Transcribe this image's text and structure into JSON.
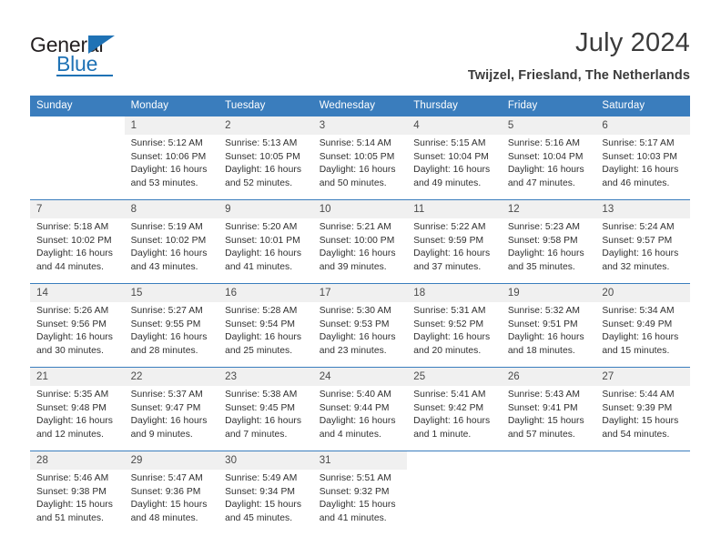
{
  "brand": {
    "word1": "General",
    "word2": "Blue",
    "triangle_icon": "triangle-icon",
    "accent_color": "#1f72b5"
  },
  "header": {
    "month_title": "July 2024",
    "location": "Twijzel, Friesland, The Netherlands"
  },
  "colors": {
    "header_row": "#3a7dbd",
    "daynum_row": "#f0f0f0",
    "text": "#2f2f2f",
    "title": "#3b3b3b"
  },
  "calendar": {
    "weekday_headers": [
      "Sunday",
      "Monday",
      "Tuesday",
      "Wednesday",
      "Thursday",
      "Friday",
      "Saturday"
    ],
    "weeks": [
      {
        "days": [
          {
            "num": "",
            "lines": []
          },
          {
            "num": "1",
            "lines": [
              "Sunrise: 5:12 AM",
              "Sunset: 10:06 PM",
              "Daylight: 16 hours",
              "and 53 minutes."
            ]
          },
          {
            "num": "2",
            "lines": [
              "Sunrise: 5:13 AM",
              "Sunset: 10:05 PM",
              "Daylight: 16 hours",
              "and 52 minutes."
            ]
          },
          {
            "num": "3",
            "lines": [
              "Sunrise: 5:14 AM",
              "Sunset: 10:05 PM",
              "Daylight: 16 hours",
              "and 50 minutes."
            ]
          },
          {
            "num": "4",
            "lines": [
              "Sunrise: 5:15 AM",
              "Sunset: 10:04 PM",
              "Daylight: 16 hours",
              "and 49 minutes."
            ]
          },
          {
            "num": "5",
            "lines": [
              "Sunrise: 5:16 AM",
              "Sunset: 10:04 PM",
              "Daylight: 16 hours",
              "and 47 minutes."
            ]
          },
          {
            "num": "6",
            "lines": [
              "Sunrise: 5:17 AM",
              "Sunset: 10:03 PM",
              "Daylight: 16 hours",
              "and 46 minutes."
            ]
          }
        ]
      },
      {
        "days": [
          {
            "num": "7",
            "lines": [
              "Sunrise: 5:18 AM",
              "Sunset: 10:02 PM",
              "Daylight: 16 hours",
              "and 44 minutes."
            ]
          },
          {
            "num": "8",
            "lines": [
              "Sunrise: 5:19 AM",
              "Sunset: 10:02 PM",
              "Daylight: 16 hours",
              "and 43 minutes."
            ]
          },
          {
            "num": "9",
            "lines": [
              "Sunrise: 5:20 AM",
              "Sunset: 10:01 PM",
              "Daylight: 16 hours",
              "and 41 minutes."
            ]
          },
          {
            "num": "10",
            "lines": [
              "Sunrise: 5:21 AM",
              "Sunset: 10:00 PM",
              "Daylight: 16 hours",
              "and 39 minutes."
            ]
          },
          {
            "num": "11",
            "lines": [
              "Sunrise: 5:22 AM",
              "Sunset: 9:59 PM",
              "Daylight: 16 hours",
              "and 37 minutes."
            ]
          },
          {
            "num": "12",
            "lines": [
              "Sunrise: 5:23 AM",
              "Sunset: 9:58 PM",
              "Daylight: 16 hours",
              "and 35 minutes."
            ]
          },
          {
            "num": "13",
            "lines": [
              "Sunrise: 5:24 AM",
              "Sunset: 9:57 PM",
              "Daylight: 16 hours",
              "and 32 minutes."
            ]
          }
        ]
      },
      {
        "days": [
          {
            "num": "14",
            "lines": [
              "Sunrise: 5:26 AM",
              "Sunset: 9:56 PM",
              "Daylight: 16 hours",
              "and 30 minutes."
            ]
          },
          {
            "num": "15",
            "lines": [
              "Sunrise: 5:27 AM",
              "Sunset: 9:55 PM",
              "Daylight: 16 hours",
              "and 28 minutes."
            ]
          },
          {
            "num": "16",
            "lines": [
              "Sunrise: 5:28 AM",
              "Sunset: 9:54 PM",
              "Daylight: 16 hours",
              "and 25 minutes."
            ]
          },
          {
            "num": "17",
            "lines": [
              "Sunrise: 5:30 AM",
              "Sunset: 9:53 PM",
              "Daylight: 16 hours",
              "and 23 minutes."
            ]
          },
          {
            "num": "18",
            "lines": [
              "Sunrise: 5:31 AM",
              "Sunset: 9:52 PM",
              "Daylight: 16 hours",
              "and 20 minutes."
            ]
          },
          {
            "num": "19",
            "lines": [
              "Sunrise: 5:32 AM",
              "Sunset: 9:51 PM",
              "Daylight: 16 hours",
              "and 18 minutes."
            ]
          },
          {
            "num": "20",
            "lines": [
              "Sunrise: 5:34 AM",
              "Sunset: 9:49 PM",
              "Daylight: 16 hours",
              "and 15 minutes."
            ]
          }
        ]
      },
      {
        "days": [
          {
            "num": "21",
            "lines": [
              "Sunrise: 5:35 AM",
              "Sunset: 9:48 PM",
              "Daylight: 16 hours",
              "and 12 minutes."
            ]
          },
          {
            "num": "22",
            "lines": [
              "Sunrise: 5:37 AM",
              "Sunset: 9:47 PM",
              "Daylight: 16 hours",
              "and 9 minutes."
            ]
          },
          {
            "num": "23",
            "lines": [
              "Sunrise: 5:38 AM",
              "Sunset: 9:45 PM",
              "Daylight: 16 hours",
              "and 7 minutes."
            ]
          },
          {
            "num": "24",
            "lines": [
              "Sunrise: 5:40 AM",
              "Sunset: 9:44 PM",
              "Daylight: 16 hours",
              "and 4 minutes."
            ]
          },
          {
            "num": "25",
            "lines": [
              "Sunrise: 5:41 AM",
              "Sunset: 9:42 PM",
              "Daylight: 16 hours",
              "and 1 minute."
            ]
          },
          {
            "num": "26",
            "lines": [
              "Sunrise: 5:43 AM",
              "Sunset: 9:41 PM",
              "Daylight: 15 hours",
              "and 57 minutes."
            ]
          },
          {
            "num": "27",
            "lines": [
              "Sunrise: 5:44 AM",
              "Sunset: 9:39 PM",
              "Daylight: 15 hours",
              "and 54 minutes."
            ]
          }
        ]
      },
      {
        "days": [
          {
            "num": "28",
            "lines": [
              "Sunrise: 5:46 AM",
              "Sunset: 9:38 PM",
              "Daylight: 15 hours",
              "and 51 minutes."
            ]
          },
          {
            "num": "29",
            "lines": [
              "Sunrise: 5:47 AM",
              "Sunset: 9:36 PM",
              "Daylight: 15 hours",
              "and 48 minutes."
            ]
          },
          {
            "num": "30",
            "lines": [
              "Sunrise: 5:49 AM",
              "Sunset: 9:34 PM",
              "Daylight: 15 hours",
              "and 45 minutes."
            ]
          },
          {
            "num": "31",
            "lines": [
              "Sunrise: 5:51 AM",
              "Sunset: 9:32 PM",
              "Daylight: 15 hours",
              "and 41 minutes."
            ]
          },
          {
            "num": "",
            "lines": []
          },
          {
            "num": "",
            "lines": []
          },
          {
            "num": "",
            "lines": []
          }
        ]
      }
    ]
  }
}
